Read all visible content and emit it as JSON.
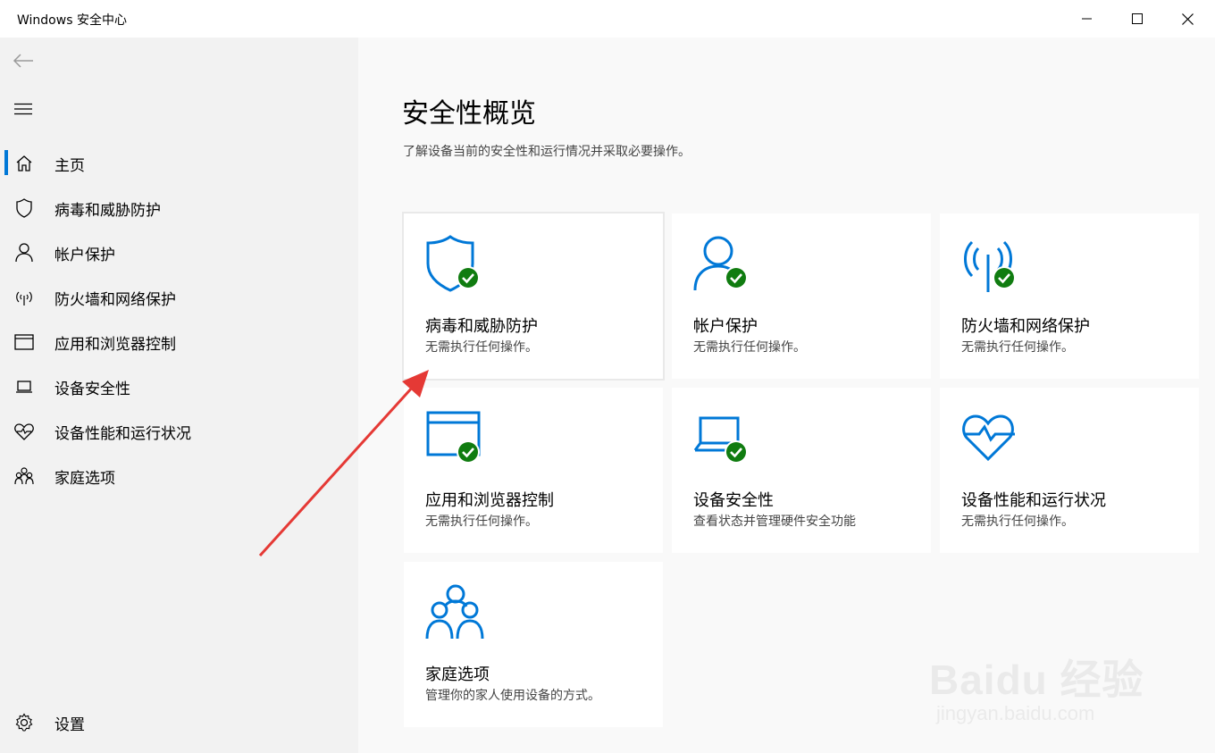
{
  "window": {
    "title": "Windows 安全中心"
  },
  "sidebar": {
    "items": [
      {
        "label": "主页",
        "icon": "home-icon"
      },
      {
        "label": "病毒和威胁防护",
        "icon": "shield-icon"
      },
      {
        "label": "帐户保护",
        "icon": "person-icon"
      },
      {
        "label": "防火墙和网络保护",
        "icon": "antenna-icon"
      },
      {
        "label": "应用和浏览器控制",
        "icon": "window-icon"
      },
      {
        "label": "设备安全性",
        "icon": "laptop-icon"
      },
      {
        "label": "设备性能和运行状况",
        "icon": "heart-icon"
      },
      {
        "label": "家庭选项",
        "icon": "family-icon"
      }
    ],
    "settings_label": "设置",
    "active_item": "主页"
  },
  "main": {
    "title": "安全性概览",
    "subtitle": "了解设备当前的安全性和运行情况并采取必要操作。",
    "tiles": [
      {
        "name": "病毒和威胁防护",
        "status": "无需执行任何操作。",
        "icon": "shield-check-icon"
      },
      {
        "name": "帐户保护",
        "status": "无需执行任何操作。",
        "icon": "person-check-icon"
      },
      {
        "name": "防火墙和网络保护",
        "status": "无需执行任何操作。",
        "icon": "antenna-check-icon"
      },
      {
        "name": "应用和浏览器控制",
        "status": "无需执行任何操作。",
        "icon": "window-check-icon"
      },
      {
        "name": "设备安全性",
        "status": "查看状态并管理硬件安全功能",
        "icon": "laptop-check-icon"
      },
      {
        "name": "设备性能和运行状况",
        "status": "无需执行任何操作。",
        "icon": "heart-pulse-icon"
      },
      {
        "name": "家庭选项",
        "status": "管理你的家人使用设备的方式。",
        "icon": "family-icon"
      }
    ]
  },
  "watermark": {
    "main": "Baidu 经验",
    "url": "jingyan.baidu.com"
  },
  "colors": {
    "accent": "#0078d7",
    "ok_green": "#107c10",
    "annotation_arrow": "#e53935"
  }
}
